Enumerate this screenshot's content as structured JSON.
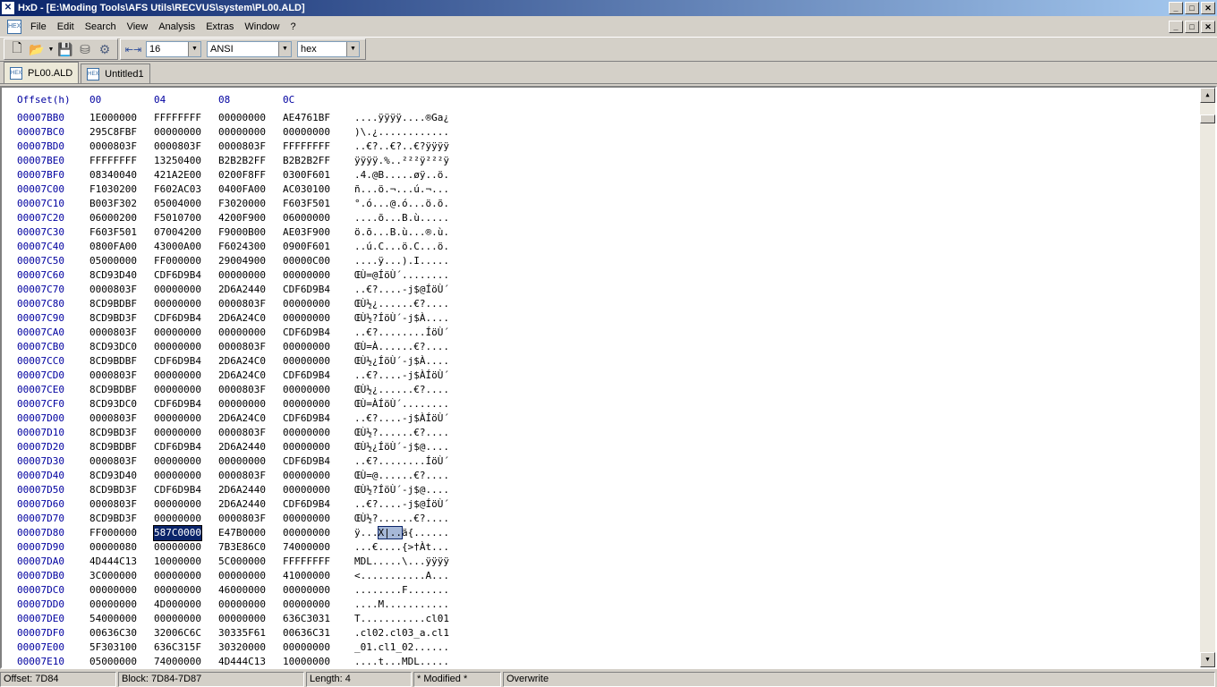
{
  "window": {
    "title": "HxD - [E:\\Moding Tools\\AFS Utils\\RECVUS\\system\\PL00.ALD]",
    "minimize": "_",
    "maximize": "□",
    "close": "✕"
  },
  "menu": {
    "items": [
      "File",
      "Edit",
      "Search",
      "View",
      "Analysis",
      "Extras",
      "Window",
      "?"
    ]
  },
  "toolbar": {
    "bytes_per_row": "16",
    "charset": "ANSI",
    "display_mode": "hex"
  },
  "tabs": [
    {
      "label": "PL00.ALD",
      "active": true
    },
    {
      "label": "Untitled1",
      "active": false
    }
  ],
  "hex": {
    "header": {
      "offset": "Offset(h)",
      "cols": [
        "00",
        "04",
        "08",
        "0C"
      ]
    },
    "rows": [
      [
        "00007BB0",
        "1E000000",
        "FFFFFFFF",
        "00000000",
        "AE4761BF",
        "....ÿÿÿÿ....®Ga¿"
      ],
      [
        "00007BC0",
        "295C8FBF",
        "00000000",
        "00000000",
        "00000000",
        ")\\.¿............"
      ],
      [
        "00007BD0",
        "0000803F",
        "0000803F",
        "0000803F",
        "FFFFFFFF",
        "..€?..€?..€?ÿÿÿÿ"
      ],
      [
        "00007BE0",
        "FFFFFFFF",
        "13250400",
        "B2B2B2FF",
        "B2B2B2FF",
        "ÿÿÿÿ.%..²²²ÿ²²²ÿ"
      ],
      [
        "00007BF0",
        "08340040",
        "421A2E00",
        "0200F8FF",
        "0300F601",
        ".4.@B.....øÿ..ö."
      ],
      [
        "00007C00",
        "F1030200",
        "F602AC03",
        "0400FA00",
        "AC030100",
        "ñ...ö.¬...ú.¬..."
      ],
      [
        "00007C10",
        "B003F302",
        "05004000",
        "F3020000",
        "F603F501",
        "°.ó...@.ó...ö.õ."
      ],
      [
        "00007C20",
        "06000200",
        "F5010700",
        "4200F900",
        "06000000",
        "....õ...B.ù....."
      ],
      [
        "00007C30",
        "F603F501",
        "07004200",
        "F9000B00",
        "AE03F900",
        "ö.õ...B.ù...®.ù."
      ],
      [
        "00007C40",
        "0800FA00",
        "43000A00",
        "F6024300",
        "0900F601",
        "..ú.C...ö.C...ö."
      ],
      [
        "00007C50",
        "05000000",
        "FF000000",
        "29004900",
        "00000C00",
        "....ÿ...).I....."
      ],
      [
        "00007C60",
        "8CD93D40",
        "CDF6D9B4",
        "00000000",
        "00000000",
        "ŒÙ=@ÍöÙ´........"
      ],
      [
        "00007C70",
        "0000803F",
        "00000000",
        "2D6A2440",
        "CDF6D9B4",
        "..€?....-j$@ÍöÙ´"
      ],
      [
        "00007C80",
        "8CD9BDBF",
        "00000000",
        "0000803F",
        "00000000",
        "ŒÙ½¿......€?...."
      ],
      [
        "00007C90",
        "8CD9BD3F",
        "CDF6D9B4",
        "2D6A24C0",
        "00000000",
        "ŒÙ½?ÍöÙ´-j$À...."
      ],
      [
        "00007CA0",
        "0000803F",
        "00000000",
        "00000000",
        "CDF6D9B4",
        "..€?........ÍöÙ´"
      ],
      [
        "00007CB0",
        "8CD93DC0",
        "00000000",
        "0000803F",
        "00000000",
        "ŒÙ=À......€?...."
      ],
      [
        "00007CC0",
        "8CD9BDBF",
        "CDF6D9B4",
        "2D6A24C0",
        "00000000",
        "ŒÙ½¿ÍöÙ´-j$À...."
      ],
      [
        "00007CD0",
        "0000803F",
        "00000000",
        "2D6A24C0",
        "CDF6D9B4",
        "..€?....-j$ÀÍöÙ´"
      ],
      [
        "00007CE0",
        "8CD9BDBF",
        "00000000",
        "0000803F",
        "00000000",
        "ŒÙ½¿......€?...."
      ],
      [
        "00007CF0",
        "8CD93DC0",
        "CDF6D9B4",
        "00000000",
        "00000000",
        "ŒÙ=ÀÍöÙ´........"
      ],
      [
        "00007D00",
        "0000803F",
        "00000000",
        "2D6A24C0",
        "CDF6D9B4",
        "..€?....-j$ÀÍöÙ´"
      ],
      [
        "00007D10",
        "8CD9BD3F",
        "00000000",
        "0000803F",
        "00000000",
        "ŒÙ½?......€?...."
      ],
      [
        "00007D20",
        "8CD9BDBF",
        "CDF6D9B4",
        "2D6A2440",
        "00000000",
        "ŒÙ½¿ÍöÙ´-j$@...."
      ],
      [
        "00007D30",
        "0000803F",
        "00000000",
        "00000000",
        "CDF6D9B4",
        "..€?........ÍöÙ´"
      ],
      [
        "00007D40",
        "8CD93D40",
        "00000000",
        "0000803F",
        "00000000",
        "ŒÙ=@......€?...."
      ],
      [
        "00007D50",
        "8CD9BD3F",
        "CDF6D9B4",
        "2D6A2440",
        "00000000",
        "ŒÙ½?ÍöÙ´-j$@...."
      ],
      [
        "00007D60",
        "0000803F",
        "00000000",
        "2D6A2440",
        "CDF6D9B4",
        "..€?....-j$@ÍöÙ´"
      ],
      [
        "00007D70",
        "8CD9BD3F",
        "00000000",
        "0000803F",
        "00000000",
        "ŒÙ½?......€?...."
      ],
      [
        "00007D80",
        "FF000000",
        "587C0000",
        "E47B0000",
        "00000000",
        "ÿ...X|..ä{......"
      ],
      [
        "00007D90",
        "00000080",
        "00000000",
        "7B3E86C0",
        "74000000",
        "...€....{>†Àt..."
      ],
      [
        "00007DA0",
        "4D444C13",
        "10000000",
        "5C000000",
        "FFFFFFFF",
        "MDL.....\\...ÿÿÿÿ"
      ],
      [
        "00007DB0",
        "3C000000",
        "00000000",
        "00000000",
        "41000000",
        "<...........A..."
      ],
      [
        "00007DC0",
        "00000000",
        "00000000",
        "46000000",
        "00000000",
        "........F......."
      ],
      [
        "00007DD0",
        "00000000",
        "4D000000",
        "00000000",
        "00000000",
        "....M..........."
      ],
      [
        "00007DE0",
        "54000000",
        "00000000",
        "00000000",
        "636C3031",
        "T...........cl01"
      ],
      [
        "00007DF0",
        "00636C30",
        "32006C6C",
        "30335F61",
        "00636C31",
        ".cl02.cl03_a.cl1"
      ],
      [
        "00007E00",
        "5F303100",
        "636C315F",
        "30320000",
        "00000000",
        "_01.cl1_02......"
      ],
      [
        "00007E10",
        "05000000",
        "74000000",
        "4D444C13",
        "10000000",
        "....t...MDL....."
      ]
    ],
    "selected_row": 29,
    "selected_col": 1,
    "ascii_selection_start": 4,
    "ascii_selection_length": 4
  },
  "status": {
    "offset": "Offset: 7D84",
    "block": "Block: 7D84-7D87",
    "length": "Length: 4",
    "modified": "* Modified *",
    "mode": "Overwrite"
  }
}
